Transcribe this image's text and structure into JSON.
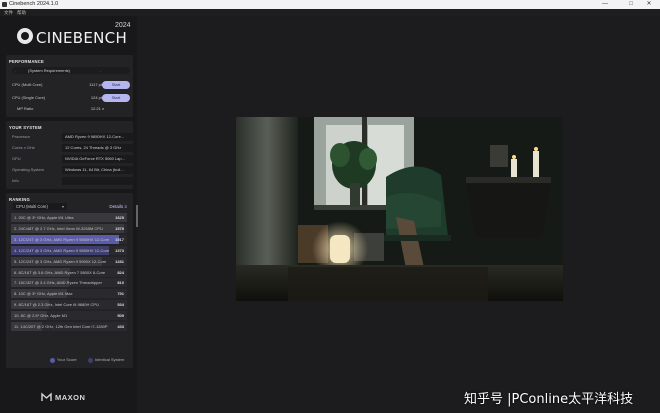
{
  "window": {
    "title": "Cinebench 2024.1.0",
    "minimize": "—",
    "maximize": "□",
    "close": "✕"
  },
  "menu": {
    "file": "文件",
    "help": "帮助"
  },
  "logo": {
    "text": "CINEBENCH",
    "year": "2024"
  },
  "performance": {
    "title": "PERFORMANCE",
    "requirements": "(System Requirements)",
    "requirements_value": "-",
    "rows": [
      {
        "label": "CPU (Multi Core)",
        "value": "1117 pts",
        "button": "Start"
      },
      {
        "label": "CPU (Single Core)",
        "value": "124 pts",
        "button": "Start"
      },
      {
        "label": "MP Ratio",
        "value": "12.21 x"
      }
    ]
  },
  "system": {
    "title": "YOUR SYSTEM",
    "rows": [
      {
        "label": "Processor",
        "value": "AMD Ryzen 9 9850HX 12-Core..."
      },
      {
        "label": "Cores x GHz",
        "value": "12 Cores, 24 Threads @ 3 GHz"
      },
      {
        "label": "GPU",
        "value": "NVIDIA GeForce RTX 5060 Lap..."
      },
      {
        "label": "Operating System",
        "value": "Windows 11, 64 Bit, China (buil..."
      },
      {
        "label": "Info",
        "value": ""
      }
    ]
  },
  "ranking": {
    "title": "RANKING",
    "mode": "CPU (Multi Core)",
    "details": "Details",
    "rows": [
      {
        "name": "1. 20C @ 3* GHz, Apple M1 Ultra",
        "score": "1625",
        "kind": "other"
      },
      {
        "name": "2. 24C/48T @ 2.7 GHz, Intel Xeon W-3265M CPU",
        "score": "1579",
        "kind": "other"
      },
      {
        "name": "3. 12C/24T @ 3 GHz, AMD Ryzen 9 9850HX 12-Core",
        "score": "1517",
        "kind": "you"
      },
      {
        "name": "4. 12C/24T @ 3 GHz, AMD Ryzen 9 9850HX 12-Core",
        "score": "1373",
        "kind": "similar"
      },
      {
        "name": "5. 12C/24T @ 3 GHz, AMD Ryzen 9 5900X 12-Core",
        "score": "1281",
        "kind": "other"
      },
      {
        "name": "6. 8C/16T @ 3.8 GHz, AMD Ryzen 7 5800X 8-Core",
        "score": "824",
        "kind": "other"
      },
      {
        "name": "7. 16C/32T @ 3.4 GHz, AMD Ryzen Threadripper",
        "score": "810",
        "kind": "other"
      },
      {
        "name": "8. 10C @ 3* GHz, Apple M1 Max",
        "score": "791",
        "kind": "other"
      },
      {
        "name": "9. 8C/16T @ 2.3 GHz, Intel Core i9-9880H CPU",
        "score": "534",
        "kind": "other"
      },
      {
        "name": "10. 8C @ 2.5* GHz, Apple M1",
        "score": "509",
        "kind": "other"
      },
      {
        "name": "11. 14C/20T @ 2 GHz, 12th Gen Intel Core i7-1280P",
        "score": "433",
        "kind": "other"
      }
    ],
    "legend": {
      "your_score": "Your Score",
      "identical": "Identical System"
    },
    "colors": {
      "your_score": "#5a5ca8",
      "identical": "#3e3f6e"
    }
  },
  "footer": {
    "brand": "MAXON"
  },
  "watermark": "知乎号 |PConline太平洋科技"
}
